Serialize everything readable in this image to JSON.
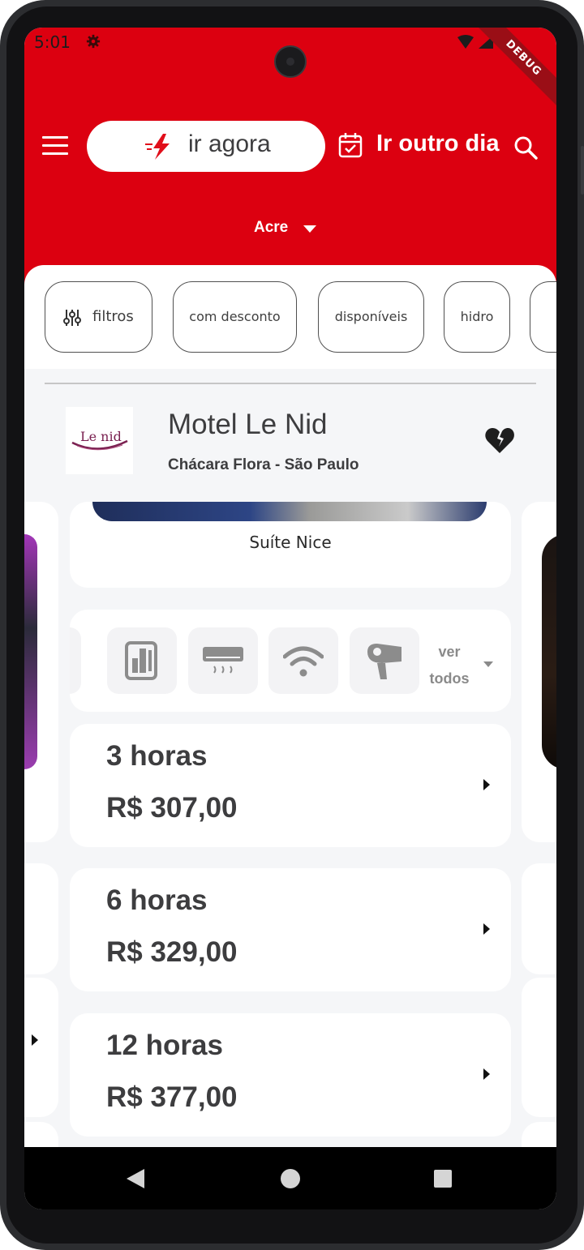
{
  "status_bar": {
    "time": "5:01",
    "debug_banner": "DEBUG"
  },
  "header": {
    "ir_agora_label": "ir agora",
    "ir_outro_dia_label": "Ir outro dia",
    "state": "Acre"
  },
  "filters": {
    "filtros_label": "filtros",
    "chips": [
      "com desconto",
      "disponíveis",
      "hidro"
    ]
  },
  "motel": {
    "logo_text": "Le nid",
    "name": "Motel Le Nid",
    "location": "Chácara Flora - São Paulo"
  },
  "suite": {
    "name": "Suíte Nice"
  },
  "amenities": {
    "icons": [
      "fridge-icon",
      "air-conditioner-icon",
      "wifi-icon",
      "hair-dryer-icon"
    ],
    "ver_todos_line1": "ver",
    "ver_todos_line2": "todos"
  },
  "prices": [
    {
      "duration": "3 horas",
      "price": "R$ 307,00"
    },
    {
      "duration": "6 horas",
      "price": "R$ 329,00"
    },
    {
      "duration": "12 horas",
      "price": "R$ 377,00"
    }
  ],
  "colors": {
    "brand_red": "#dc0010",
    "text_dark": "#3d3d3f",
    "background": "#f5f6f8"
  }
}
